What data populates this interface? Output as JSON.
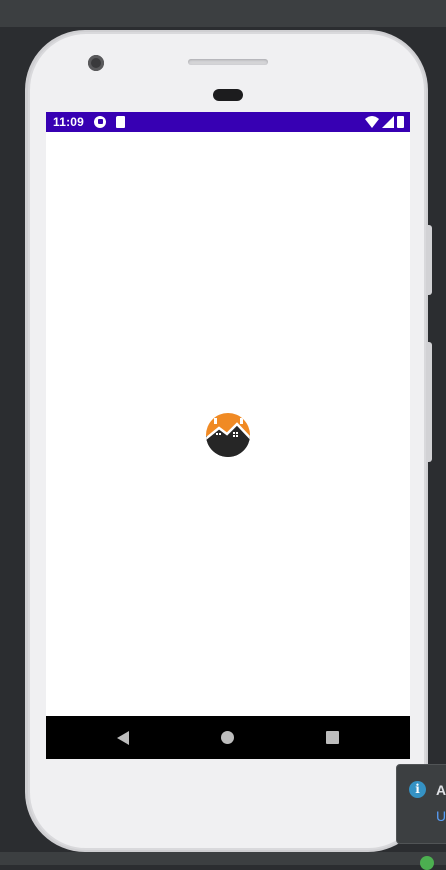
{
  "status_bar": {
    "time": "11:09",
    "background": "#3700b3"
  },
  "app": {
    "logo_icon": "house-roof-logo-icon",
    "logo_colors": [
      "#f08a24",
      "#262626",
      "#ffffff"
    ]
  },
  "nav_bar": {
    "back_icon": "back-triangle-icon",
    "home_icon": "home-circle-icon",
    "recent_icon": "recent-square-icon"
  },
  "notification": {
    "icon": "info-icon",
    "icon_glyph": "i",
    "title": "A",
    "link": "U"
  },
  "colors": {
    "ide_background": "#2b2d30",
    "screen": "#ffffff",
    "navbar": "#000000",
    "info_blue": "#3592c4",
    "link_blue": "#589df6"
  }
}
